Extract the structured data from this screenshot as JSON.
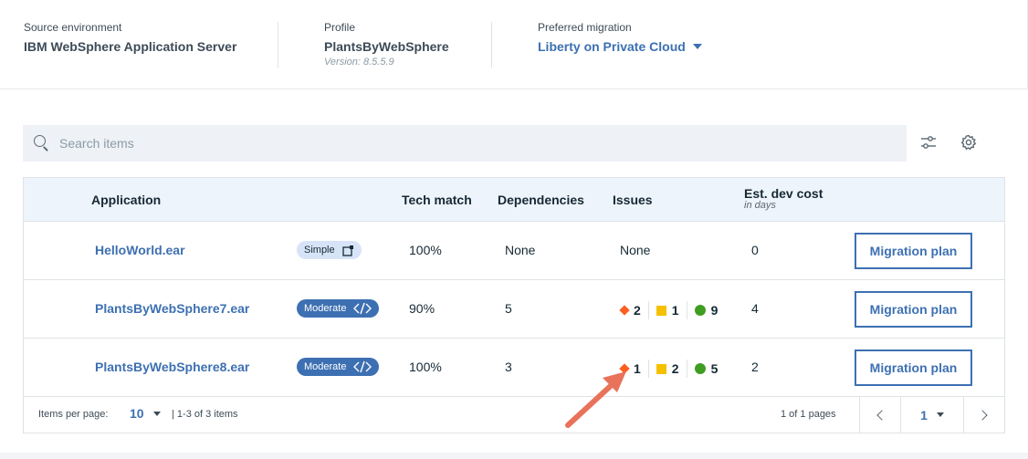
{
  "summary": {
    "source": {
      "label": "Source environment",
      "value": "IBM WebSphere Application Server"
    },
    "profile": {
      "label": "Profile",
      "value": "PlantsByWebSphere",
      "version": "Version: 8.5.5.9"
    },
    "migration": {
      "label": "Preferred migration",
      "value": "Liberty on Private Cloud"
    }
  },
  "search": {
    "placeholder": "Search items"
  },
  "table": {
    "headers": {
      "application": "Application",
      "tech_match": "Tech match",
      "dependencies": "Dependencies",
      "issues": "Issues",
      "dev_cost": "Est. dev cost",
      "dev_cost_sub": "in days"
    },
    "rows": [
      {
        "name": "HelloWorld.ear",
        "complexity": "Simple",
        "tech_match": "100%",
        "dependencies": "None",
        "issues_text": "None",
        "cost": "0",
        "action": "Migration plan"
      },
      {
        "name": "PlantsByWebSphere7.ear",
        "complexity": "Moderate",
        "tech_match": "90%",
        "dependencies": "5",
        "issues": {
          "critical": "2",
          "warning": "1",
          "info": "9"
        },
        "cost": "4",
        "action": "Migration plan"
      },
      {
        "name": "PlantsByWebSphere8.ear",
        "complexity": "Moderate",
        "tech_match": "100%",
        "dependencies": "3",
        "issues": {
          "critical": "1",
          "warning": "2",
          "info": "5"
        },
        "cost": "2",
        "action": "Migration plan"
      }
    ]
  },
  "pagination": {
    "items_per_page_label": "Items per page:",
    "items_per_page": "10",
    "range": "|  1-3 of 3 items",
    "pages": "1 of 1 pages",
    "current_page": "1"
  },
  "colors": {
    "accent": "#3d70b2",
    "critical": "#fe5e1f",
    "warning": "#f5c000",
    "info": "#3f9d22",
    "annotation_arrow": "#e8735a"
  }
}
